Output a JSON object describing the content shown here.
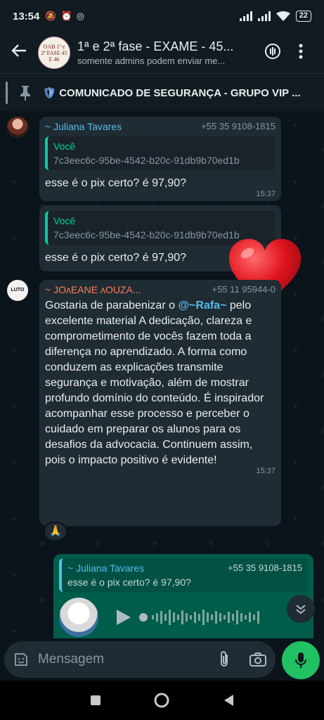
{
  "status_bar": {
    "time": "13:54",
    "battery": "22"
  },
  "header": {
    "title": "1ª e 2ª fase - EXAME - 45...",
    "subtitle": "somente admins podem enviar me...",
    "avatar_text": "OAB 1ª e 2ª FASE 45 E 46"
  },
  "pinned": {
    "text": "COMUNICADO DE SEGURANÇA - GRUPO VIP ..."
  },
  "messages": [
    {
      "sender": "~ Juliana Tavares",
      "phone": "+55 35 9108-1815",
      "quote_name": "Você",
      "quote_text": "7c3eec6c-95be-4542-b20c-91db9b70ed1b",
      "text": "esse é o pix certo? é 97,90?",
      "time": "15:37"
    },
    {
      "quote_name": "Você",
      "quote_text": "7c3eec6c-95be-4542-b20c-91db9b70ed1b",
      "text": "esse é o pix certo? é 97,90?"
    },
    {
      "sender": "~ JOʌEANE ʌOUZA...",
      "phone": "+55 11 95944-0",
      "text_before": "Gostaria de parabenizar o ",
      "mention": "@~Rafa~",
      "text_after": " pelo excelente material  A dedicação, clareza e comprometimento de vocês fazem toda a diferença no aprendizado. A forma como conduzem as explicações transmite segurança e motivação, além de mostrar profundo domínio do conteúdo. É inspirador acompanhar esse processo e perceber o cuidado em preparar os alunos para os desafios da advocacia. Continuem assim, pois o impacto positivo é evidente!",
      "time": "15:37",
      "reaction": "🙏",
      "avatar_text": "LUTO"
    },
    {
      "quote_name": "~ Juliana Tavares",
      "quote_phone": "+55 35 9108-1815",
      "quote_text": "esse é o pix certo? é 97,90?"
    }
  ],
  "input": {
    "placeholder": "Mensagem"
  },
  "colors": {
    "accent": "#21c063",
    "mention": "#53bdeb",
    "quote_bar": "#06cf9c"
  }
}
